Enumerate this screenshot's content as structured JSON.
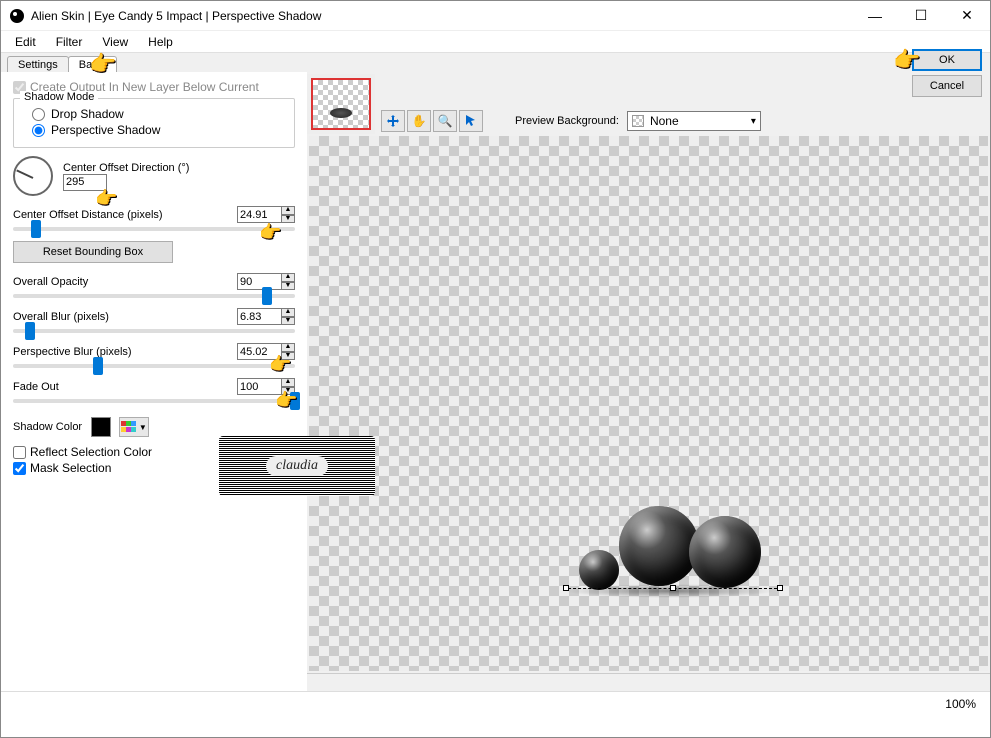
{
  "window": {
    "title": "Alien Skin | Eye Candy 5 Impact | Perspective Shadow"
  },
  "menu": {
    "edit": "Edit",
    "filter": "Filter",
    "view": "View",
    "help": "Help"
  },
  "tabs": {
    "settings": "Settings",
    "basic": "Basic"
  },
  "panel": {
    "create_output": "Create Output In New Layer Below Current",
    "shadow_mode_title": "Shadow Mode",
    "drop_shadow": "Drop Shadow",
    "perspective_shadow": "Perspective Shadow",
    "center_offset_dir_label": "Center Offset Direction (°)",
    "center_offset_dir_value": "295",
    "center_offset_dist_label": "Center Offset Distance (pixels)",
    "center_offset_dist_value": "24.91",
    "reset_bbox": "Reset Bounding Box",
    "overall_opacity_label": "Overall Opacity",
    "overall_opacity_value": "90",
    "overall_blur_label": "Overall Blur (pixels)",
    "overall_blur_value": "6.83",
    "perspective_blur_label": "Perspective Blur (pixels)",
    "perspective_blur_value": "45.02",
    "fadeout_label": "Fade Out",
    "fadeout_value": "100",
    "shadow_color_label": "Shadow Color",
    "shadow_color_value": "#000000",
    "reflect_sel_color": "Reflect Selection Color",
    "mask_selection": "Mask Selection"
  },
  "preview": {
    "bg_label": "Preview Background:",
    "bg_value": "None"
  },
  "buttons": {
    "ok": "OK",
    "cancel": "Cancel"
  },
  "status": {
    "zoom": "100%"
  },
  "logo": {
    "text": "claudia"
  }
}
